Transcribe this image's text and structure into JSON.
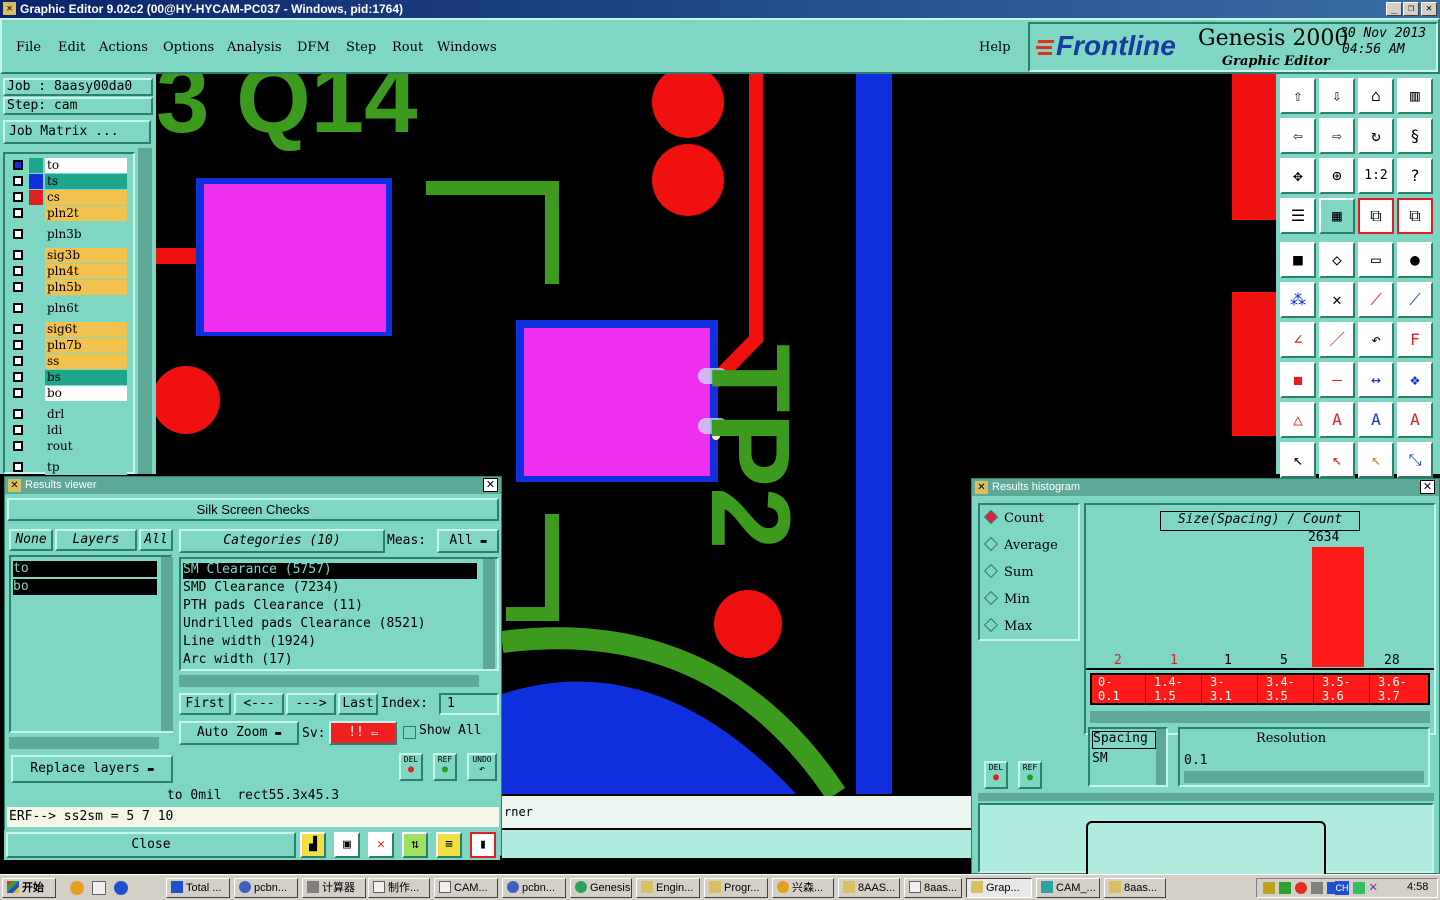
{
  "window": {
    "title": "Graphic Editor 9.02c2 (00@HY-HYCAM-PC037 - Windows, pid:1764)"
  },
  "menu": [
    "File",
    "Edit",
    "Actions",
    "Options",
    "Analysis",
    "DFM",
    "Step",
    "Rout",
    "Windows"
  ],
  "help": "Help",
  "brand": {
    "logo": "Frontline",
    "product": "Genesis 2000",
    "subtitle": "Graphic Editor",
    "date": "30 Nov 2013",
    "time": "04:56 AM"
  },
  "job": {
    "job": "Job  : 8aasy00da0",
    "step": "Step: cam",
    "matrix_btn": "Job Matrix ..."
  },
  "layers": [
    {
      "name": "to",
      "color": "#ffffff"
    },
    {
      "name": "ts",
      "color": "#1fa58c"
    },
    {
      "name": "cs",
      "color": "#f2c14e"
    },
    {
      "name": "pln2t",
      "color": "#f2c14e"
    },
    {
      "name": "pln3b",
      "color": "#7fd6c2"
    },
    {
      "name": "sig3b",
      "color": "#f2c14e"
    },
    {
      "name": "pln4t",
      "color": "#f2c14e"
    },
    {
      "name": "pln5b",
      "color": "#f2c14e"
    },
    {
      "name": "pln6t",
      "color": "#7fd6c2"
    },
    {
      "name": "sig6t",
      "color": "#f2c14e"
    },
    {
      "name": "pln7b",
      "color": "#f2c14e"
    },
    {
      "name": "ss",
      "color": "#f2c14e"
    },
    {
      "name": "bs",
      "color": "#1fa58c"
    },
    {
      "name": "bo",
      "color": "#ffffff"
    },
    {
      "name": "drl",
      "color": "#7fd6c2"
    },
    {
      "name": "ldi",
      "color": "#7fd6c2"
    },
    {
      "name": "rout",
      "color": "#7fd6c2"
    },
    {
      "name": "tp",
      "color": "#7fd6c2"
    }
  ],
  "canvas": {
    "silk_text_1": "3 Q14",
    "silk_text_2": "TP2",
    "status_fragment": "rner"
  },
  "results_viewer": {
    "title": "Results viewer",
    "heading": "Silk Screen Checks",
    "none": "None",
    "layers": "Layers",
    "all": "All",
    "categories_btn": "Categories (10)",
    "meas_label": "Meas:",
    "meas_value": "All",
    "layer_items": [
      "to",
      "bo"
    ],
    "categories": [
      "SM Clearance (5757)",
      "SMD Clearance (7234)",
      "PTH pads Clearance (11)",
      "Undrilled pads Clearance (8521)",
      "Line width (1924)",
      "Arc width (17)"
    ],
    "first": "First",
    "prev": "<---",
    "next": "--->",
    "last": "Last",
    "index_label": "Index:",
    "index_value": "1",
    "auto_zoom": "Auto Zoom",
    "sv_label": "Sv:",
    "sv_value": "!!",
    "show_all": "Show All",
    "replace_layers": "Replace layers",
    "del": "DEL",
    "ref": "REF",
    "undo": "UNDO",
    "status_line": "to 0mil  rect55.3x45.3",
    "erf_line": "ERF--> ss2sm = 5 7 10",
    "close": "Close"
  },
  "histogram": {
    "title": "Results histogram",
    "modes": [
      "Count",
      "Average",
      "Sum",
      "Min",
      "Max"
    ],
    "selected_mode": "Count",
    "chart_title": "Size(Spacing) / Count",
    "peak_label": "2634",
    "counts": [
      "2",
      "1",
      "1",
      "5",
      "",
      "28"
    ],
    "count_values": [
      2,
      1,
      1,
      5,
      2634,
      28
    ],
    "bins": [
      [
        "0-",
        "0.1"
      ],
      [
        "1.4-",
        "1.5"
      ],
      [
        "3-",
        "3.1"
      ],
      [
        "3.4-",
        "3.5"
      ],
      [
        "3.5-",
        "3.6"
      ],
      [
        "3.6-",
        "3.7"
      ]
    ],
    "spacing_label": "Spacing",
    "sm_label": "SM",
    "resolution_label": "Resolution",
    "resolution_value": "0.1",
    "del": "DEL",
    "ref": "REF"
  },
  "taskbar": {
    "start": "开始",
    "tasks": [
      "Total ...",
      "pcbn...",
      "计算器",
      "制作...",
      "CAM...",
      "pcbn...",
      "Genesis",
      "Engin...",
      "Progr...",
      "兴森...",
      "8AAS...",
      "8aas...",
      "Grap...",
      "CAM_...",
      "8aas..."
    ],
    "clock": "4:58",
    "lang": "CH"
  }
}
